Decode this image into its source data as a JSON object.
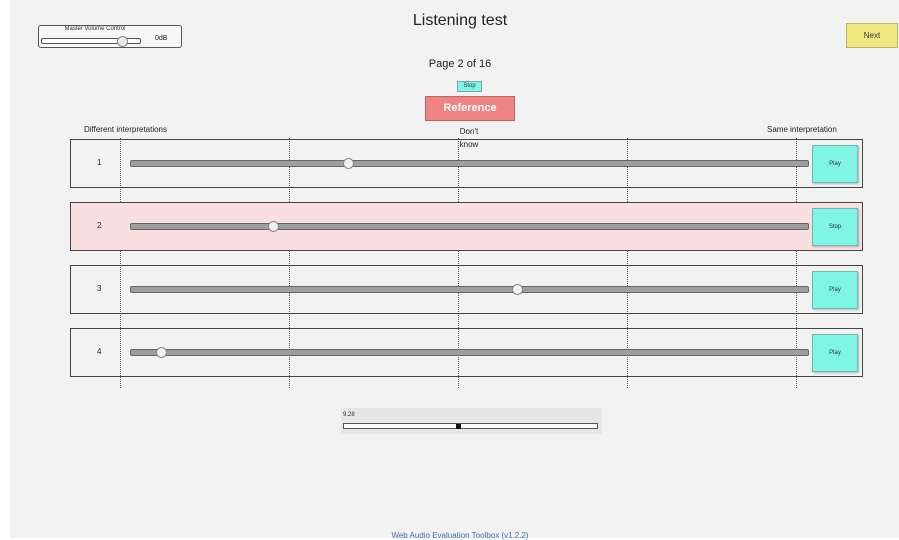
{
  "header": {
    "master_volume": {
      "title": "Master Volume Control",
      "level": "0dB",
      "slider_fraction": 0.82
    },
    "title": "Listening test",
    "next_label": "Next"
  },
  "page_indicator": "Page 2 of 16",
  "stop_label": "Stop",
  "reference_label": "Reference",
  "scale": {
    "left": "Different interpretations",
    "middle": "Don't know",
    "right": "Same interpretation"
  },
  "rows": [
    {
      "number": "1",
      "button": "Play",
      "value": 0.32,
      "active": false
    },
    {
      "number": "2",
      "button": "Stop",
      "value": 0.21,
      "active": true
    },
    {
      "number": "3",
      "button": "Play",
      "value": 0.57,
      "active": false
    },
    {
      "number": "4",
      "button": "Play",
      "value": 0.045,
      "active": false
    }
  ],
  "playback": {
    "time": "9.28",
    "position_fraction": 0.45
  },
  "footer": "Web Audio Evaluation Toolbox (v1.2.2)",
  "colors": {
    "play_button": "#7ef5e5",
    "reference_button": "#f08383",
    "next_button": "#efe881",
    "active_row": "#f9dfdf"
  }
}
